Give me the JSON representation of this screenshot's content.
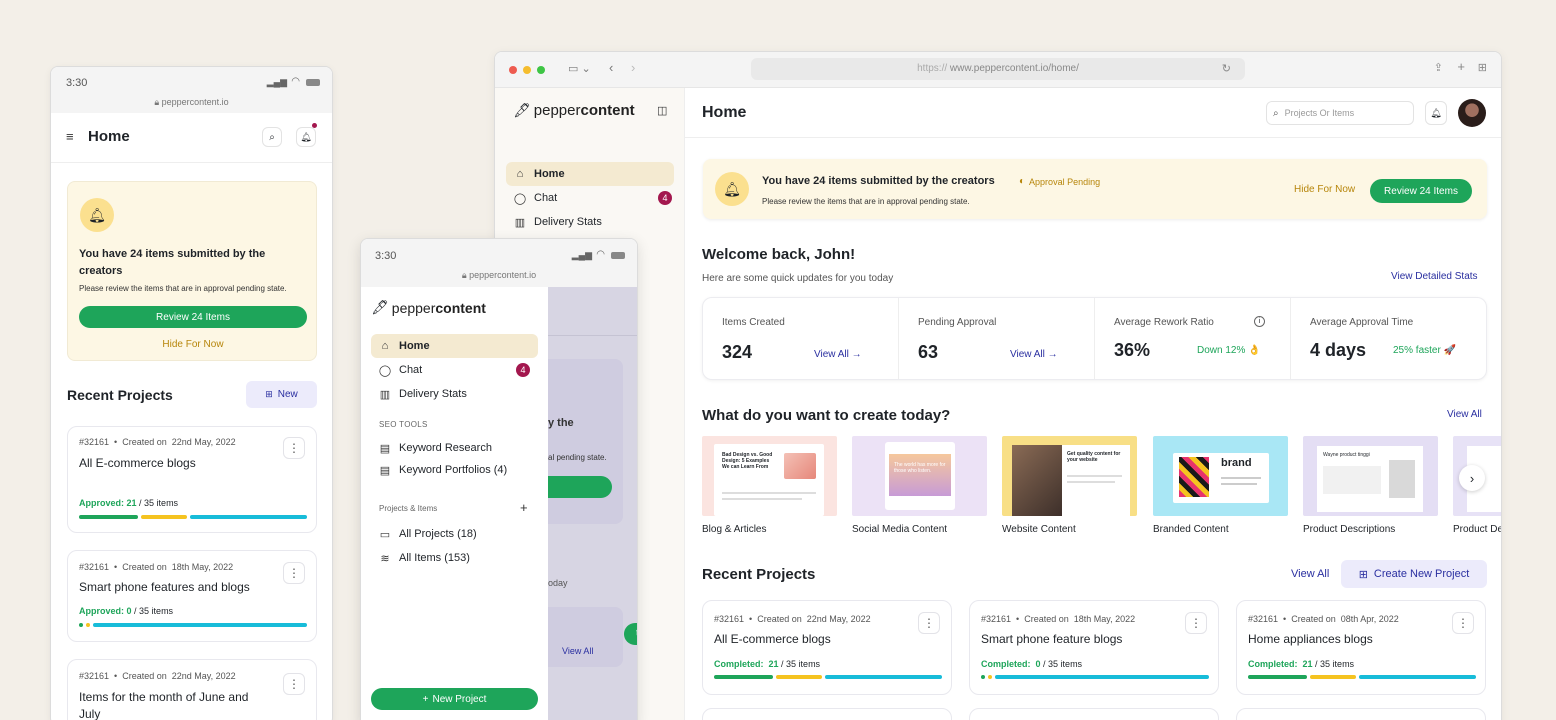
{
  "mobile1": {
    "time": "3:30",
    "url": "peppercontent.io",
    "title": "Home",
    "banner": {
      "heading": "You have 24 items submitted by the creators",
      "sub": "Please review the items that are in approval pending state.",
      "review": "Review 24 Items",
      "hide": "Hide For Now"
    },
    "recent_title": "Recent Projects",
    "new_label": "New",
    "projects": [
      {
        "id": "#32161",
        "created": "Created on",
        "date": "22nd May, 2022",
        "title": "All E-commerce blogs",
        "status": "Approved:",
        "count": "21",
        "total": "/ 35 items"
      },
      {
        "id": "#32161",
        "created": "Created on",
        "date": "18th May, 2022",
        "title": "Smart phone features and blogs",
        "status": "Approved:",
        "count": "0",
        "total": "/ 35 items"
      },
      {
        "id": "#32161",
        "created": "Created on",
        "date": "22nd May, 2022",
        "title": "Items for the month of June and July"
      }
    ]
  },
  "mobile2": {
    "time": "3:30",
    "url": "peppercontent.io",
    "logo_a": "pepper",
    "logo_b": "content",
    "nav": [
      {
        "label": "Home",
        "icon": "home-icon"
      },
      {
        "label": "Chat",
        "icon": "chat-icon",
        "badge": "4"
      },
      {
        "label": "Delivery Stats",
        "icon": "bar-chart-icon"
      }
    ],
    "seo_header": "SEO TOOLS",
    "seo": [
      {
        "label": "Keyword Research",
        "icon": "document-icon"
      },
      {
        "label": "Keyword Portfolios (4)",
        "icon": "document-icon"
      }
    ],
    "proj_header": "Projects & Items",
    "proj_items": [
      {
        "label": "All Projects (18)",
        "icon": "folder-icon"
      },
      {
        "label": "All Items (153)",
        "icon": "layers-icon"
      }
    ],
    "new_project": "New Project",
    "bg_fragments": {
      "a": "y the",
      "b": "al pending state.",
      "c": "oday",
      "d": "View All",
      "e": "t"
    }
  },
  "browser": {
    "url_prefix": "https://",
    "url": "www.peppercontent.io/home/",
    "logo_a": "pepper",
    "logo_b": "content",
    "nav": [
      {
        "label": "Home",
        "icon": "home-icon"
      },
      {
        "label": "Chat",
        "icon": "chat-icon",
        "badge": "4"
      },
      {
        "label": "Delivery Stats",
        "icon": "bar-chart-icon"
      }
    ],
    "page_title": "Home",
    "search_placeholder": "Projects Or Items",
    "banner": {
      "heading": "You have 24 items submitted by the creators",
      "status": "Approval Pending",
      "sub": "Please review the items that are in approval pending state.",
      "hide": "Hide For Now",
      "review": "Review 24 Items"
    },
    "welcome": "Welcome back, John!",
    "welcome_sub": "Here are some quick updates for you today",
    "view_detailed": "View Detailed Stats",
    "stats": [
      {
        "label": "Items Created",
        "value": "324",
        "link": "View All →"
      },
      {
        "label": "Pending Approval",
        "value": "63",
        "link": "View All →"
      },
      {
        "label": "Average Rework Ratio",
        "value": "36%",
        "note": "Down 12% 👌"
      },
      {
        "label": "Average Approval Time",
        "value": "4 days",
        "note": "25% faster 🚀"
      }
    ],
    "create_title": "What do you want to create today?",
    "create_view_all": "View All",
    "content_types": [
      {
        "label": "Blog & Articles",
        "color": "#fbe4e0"
      },
      {
        "label": "Social Media Content",
        "color": "#ece2f6"
      },
      {
        "label": "Website Content",
        "color": "#f8df86"
      },
      {
        "label": "Branded Content",
        "color": "#a9e7f5"
      },
      {
        "label": "Product Descriptions",
        "color": "#e4def4"
      },
      {
        "label": "Product De",
        "color": "#e7e2f6"
      }
    ],
    "thumb_text": {
      "blog": "Bad Design vs. Good Design: 5 Examples We can Learn From",
      "social": "The world has more for those who listen.",
      "website": "Get quality content for your website",
      "brand": "brand",
      "product": "Wayne product tinggi"
    },
    "recent_title": "Recent Projects",
    "recent_view_all": "View All",
    "create_new": "Create New Project",
    "projects": [
      {
        "id": "#32161",
        "created": "Created on",
        "date": "22nd May, 2022",
        "title": "All E-commerce blogs",
        "status": "Completed:",
        "count": "21",
        "total": "/ 35 items"
      },
      {
        "id": "#32161",
        "created": "Created on",
        "date": "18th May, 2022",
        "title": "Smart phone feature blogs",
        "status": "Completed:",
        "count": "0",
        "total": "/ 35 items"
      },
      {
        "id": "#32161",
        "created": "Created on",
        "date": "08th Apr, 2022",
        "title": "Home appliances blogs",
        "status": "Completed:",
        "count": "21",
        "total": "/ 35 items"
      }
    ]
  },
  "colors": {
    "green": "#1ea55a",
    "amber": "#f5c320",
    "cyan": "#17bcd9",
    "badge": "#a3174e",
    "link": "#2a2fa0",
    "banner": "#fdf7e4"
  }
}
